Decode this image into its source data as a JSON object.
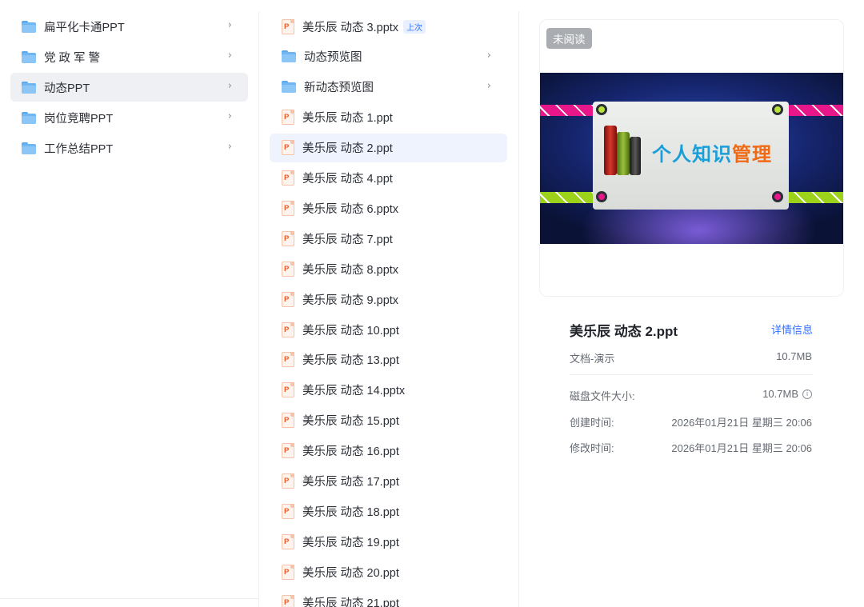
{
  "col1": {
    "folders": [
      {
        "label": "扁平化卡通PPT"
      },
      {
        "label": "党 政 军 警"
      },
      {
        "label": "动态PPT",
        "selected": true
      },
      {
        "label": "岗位竞聘PPT"
      },
      {
        "label": "工作总结PPT"
      }
    ],
    "chevron": "›"
  },
  "col2": {
    "items": [
      {
        "type": "ppt",
        "label": "美乐辰 动态 3.pptx",
        "badge": "上次"
      },
      {
        "type": "folder",
        "label": "动态预览图"
      },
      {
        "type": "folder",
        "label": "新动态预览图"
      },
      {
        "type": "ppt",
        "label": "美乐辰 动态 1.ppt"
      },
      {
        "type": "ppt",
        "label": "美乐辰 动态 2.ppt",
        "selected": true
      },
      {
        "type": "ppt",
        "label": "美乐辰 动态 4.ppt"
      },
      {
        "type": "ppt",
        "label": "美乐辰 动态 6.pptx"
      },
      {
        "type": "ppt",
        "label": "美乐辰 动态 7.ppt"
      },
      {
        "type": "ppt",
        "label": "美乐辰 动态 8.pptx"
      },
      {
        "type": "ppt",
        "label": "美乐辰 动态 9.pptx"
      },
      {
        "type": "ppt",
        "label": "美乐辰 动态 10.ppt"
      },
      {
        "type": "ppt",
        "label": "美乐辰 动态 13.ppt"
      },
      {
        "type": "ppt",
        "label": "美乐辰 动态 14.pptx"
      },
      {
        "type": "ppt",
        "label": "美乐辰 动态 15.ppt"
      },
      {
        "type": "ppt",
        "label": "美乐辰 动态 16.ppt"
      },
      {
        "type": "ppt",
        "label": "美乐辰 动态 17.ppt"
      },
      {
        "type": "ppt",
        "label": "美乐辰 动态 18.ppt"
      },
      {
        "type": "ppt",
        "label": "美乐辰 动态 19.ppt"
      },
      {
        "type": "ppt",
        "label": "美乐辰 动态 20.ppt"
      },
      {
        "type": "ppt",
        "label": "美乐辰 动态 21.ppt"
      }
    ]
  },
  "preview": {
    "unread": "未阅读",
    "slide_title_a": "个人知识",
    "slide_title_b": "管理"
  },
  "details": {
    "filename": "美乐辰 动态 2.ppt",
    "detail_link": "详情信息",
    "type": "文档-演示",
    "size": "10.7MB",
    "disk_size_label": "磁盘文件大小:",
    "disk_size_value": "10.7MB",
    "created_label": "创建时间:",
    "created_value": "2026年01月21日 星期三 20:06",
    "modified_label": "修改时间:",
    "modified_value": "2026年01月21日 星期三 20:06"
  },
  "colors": {
    "accent": "#3370ff",
    "selected_bg": "#eef3fd",
    "folder": "#6fb6f3",
    "ppt": "#ee5d2a"
  },
  "icons": {
    "folder": "folder-icon",
    "ppt": "ppt-file-icon",
    "chevron": "chevron-right-icon",
    "info": "info-circle-icon"
  }
}
